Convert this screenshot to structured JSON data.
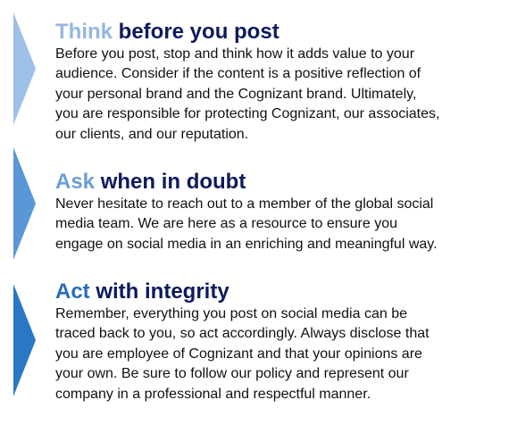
{
  "colors": {
    "heading_dark": "#0f1a5c",
    "body_text": "#111111",
    "think_keyword": "#95b7e1",
    "ask_keyword": "#6a9ed6",
    "act_keyword": "#2a6cb7",
    "chevron_1": "#9dc0e8",
    "chevron_2": "#5b96d6",
    "chevron_3": "#2a77c6"
  },
  "sections": [
    {
      "keyword": "Think",
      "heading_rest": " before you post",
      "lines": [
        "Before you post, stop and think how it adds value to your",
        "audience. Consider if the content is a positive reflection of",
        "your personal brand and the Cognizant brand. Ultimately,",
        "you are responsible for protecting Cognizant, our associates,",
        "our clients, and our reputation."
      ]
    },
    {
      "keyword": "Ask",
      "heading_rest": " when in doubt",
      "lines": [
        "Never hesitate to reach out to a member of the global social",
        "media team. We are here as a resource to ensure you",
        "engage on social media in an enriching and meaningful way."
      ]
    },
    {
      "keyword": "Act",
      "heading_rest": " with integrity",
      "lines": [
        "Remember, everything you post on social media can be",
        "traced back to you, so act accordingly. Always disclose that",
        "you are employee of Cognizant and that your opinions are",
        "your own. Be sure to follow our policy and represent our",
        "company in a professional and respectful manner."
      ]
    }
  ]
}
